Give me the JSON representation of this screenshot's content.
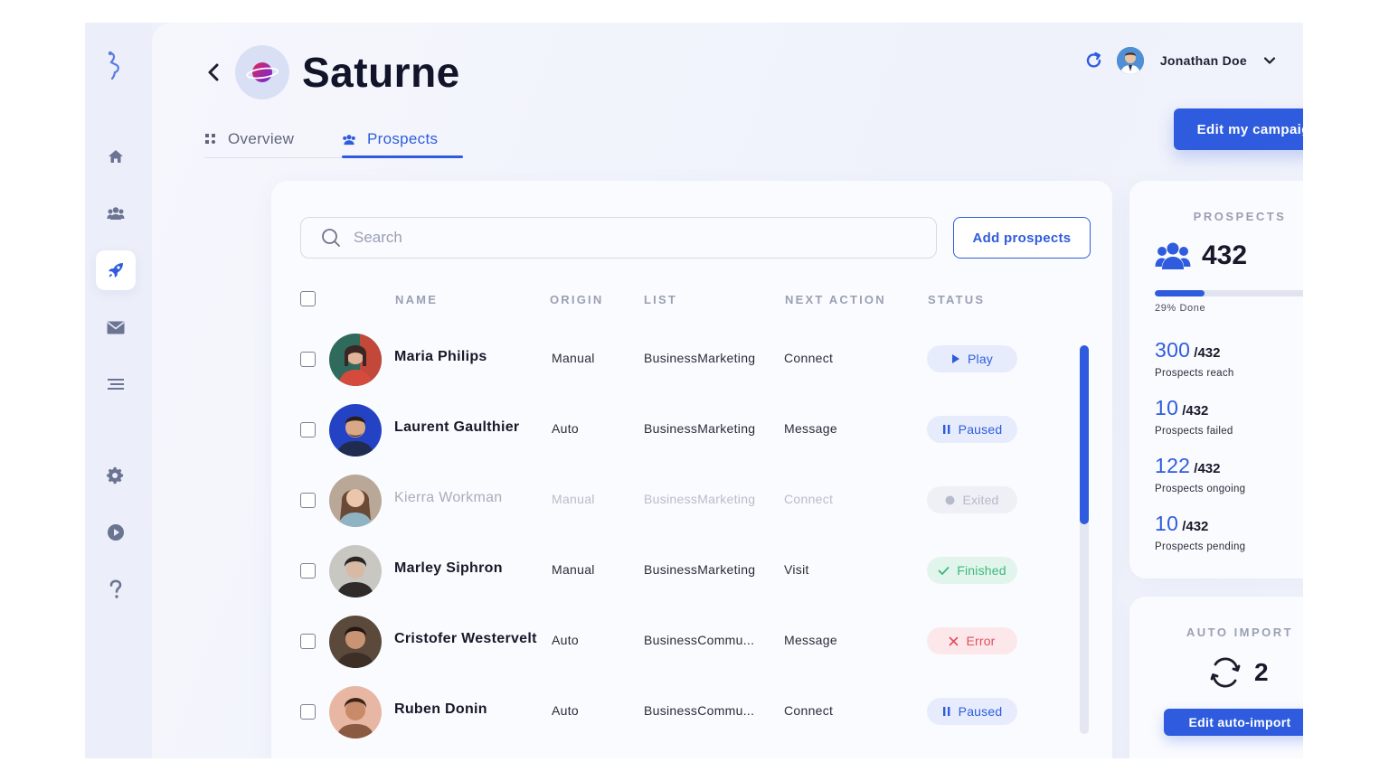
{
  "app": {
    "title": "Saturne"
  },
  "user": {
    "name": "Jonathan Doe"
  },
  "header": {
    "edit_campaign_label": "Edit my campaign"
  },
  "tabs": [
    {
      "label": "Overview",
      "icon": "grid-icon",
      "active": false
    },
    {
      "label": "Prospects",
      "icon": "users-icon",
      "active": true
    }
  ],
  "sidebar": {
    "items": [
      {
        "icon": "home-icon",
        "active": false
      },
      {
        "icon": "users-icon",
        "active": false
      },
      {
        "icon": "rocket-icon",
        "active": true
      },
      {
        "icon": "mail-icon",
        "active": false
      },
      {
        "icon": "list-icon",
        "active": false
      },
      {
        "icon": "gear-icon",
        "active": false
      },
      {
        "icon": "play-circle-icon",
        "active": false
      },
      {
        "icon": "help-icon",
        "active": false
      }
    ]
  },
  "search": {
    "placeholder": "Search",
    "value": ""
  },
  "add_prospects_label": "Add prospects",
  "table": {
    "columns": [
      "NAME",
      "ORIGIN",
      "LIST",
      "NEXT ACTION",
      "STATUS"
    ],
    "rows": [
      {
        "name": "Maria Philips",
        "origin": "Manual",
        "list": "BusinessMarketing",
        "next_action": "Connect",
        "status": "Play",
        "status_type": "play",
        "dim": false
      },
      {
        "name": "Laurent Gaulthier",
        "origin": "Auto",
        "list": "BusinessMarketing",
        "next_action": "Message",
        "status": "Paused",
        "status_type": "paused",
        "dim": false
      },
      {
        "name": "Kierra Workman",
        "origin": "Manual",
        "list": "BusinessMarketing",
        "next_action": "Connect",
        "status": "Exited",
        "status_type": "exited",
        "dim": true
      },
      {
        "name": "Marley Siphron",
        "origin": "Manual",
        "list": "BusinessMarketing",
        "next_action": "Visit",
        "status": "Finished",
        "status_type": "finished",
        "dim": false
      },
      {
        "name": "Cristofer Westervelt",
        "origin": "Auto",
        "list": "BusinessCommu...",
        "next_action": "Message",
        "status": "Error",
        "status_type": "error",
        "dim": false
      },
      {
        "name": "Ruben Donin",
        "origin": "Auto",
        "list": "BusinessCommu...",
        "next_action": "Connect",
        "status": "Paused",
        "status_type": "paused",
        "dim": false
      }
    ]
  },
  "stats": {
    "title": "PROSPECTS",
    "total": "432",
    "progress_fraction": 0.29,
    "done_label": "29%  Done",
    "items": [
      {
        "value": "300",
        "total": "/432",
        "label": "Prospects reach"
      },
      {
        "value": "10",
        "total": "/432",
        "label": "Prospects failed"
      },
      {
        "value": "122",
        "total": "/432",
        "label": "Prospects ongoing"
      },
      {
        "value": "10",
        "total": "/432",
        "label": "Prospects pending"
      }
    ]
  },
  "auto_import": {
    "title": "AUTO IMPORT",
    "count": "2",
    "button_label": "Edit auto-import"
  },
  "colors": {
    "accent": "#2f5cde",
    "success": "#3cb87a",
    "error": "#e24f5f",
    "muted": "#9aa0b4"
  }
}
